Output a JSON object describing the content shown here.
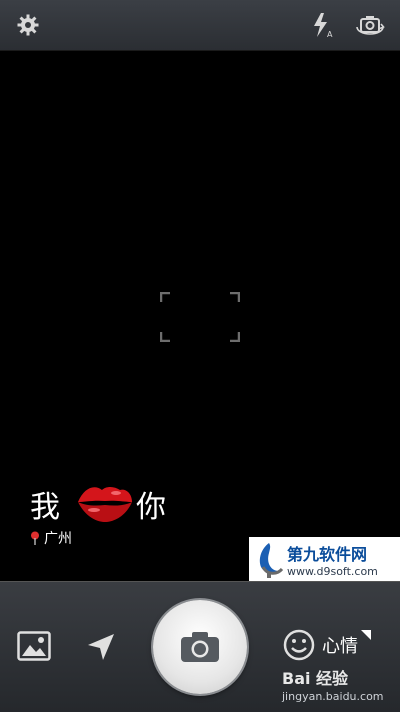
{
  "top_bar": {
    "settings_icon": "gear-icon",
    "flash_icon": "flash-auto-icon",
    "switch_camera_icon": "camera-switch-icon"
  },
  "sticker": {
    "text_left": "我",
    "text_right": "你",
    "location": "广州"
  },
  "watermark": {
    "title": "第九软件网",
    "url": "www.d9soft.com"
  },
  "bottom_bar": {
    "gallery_icon": "gallery-icon",
    "location_icon": "location-arrow-icon",
    "shutter_icon": "camera-icon",
    "mood_icon": "smiley-icon",
    "mood_label": "心情"
  },
  "footer": {
    "baidu": "Bai 经验",
    "url": "jingyan.baidu.com"
  },
  "colors": {
    "bar_bg": "#2f3237",
    "lips_red": "#d4151b",
    "watermark_blue": "#0b4d9b"
  }
}
